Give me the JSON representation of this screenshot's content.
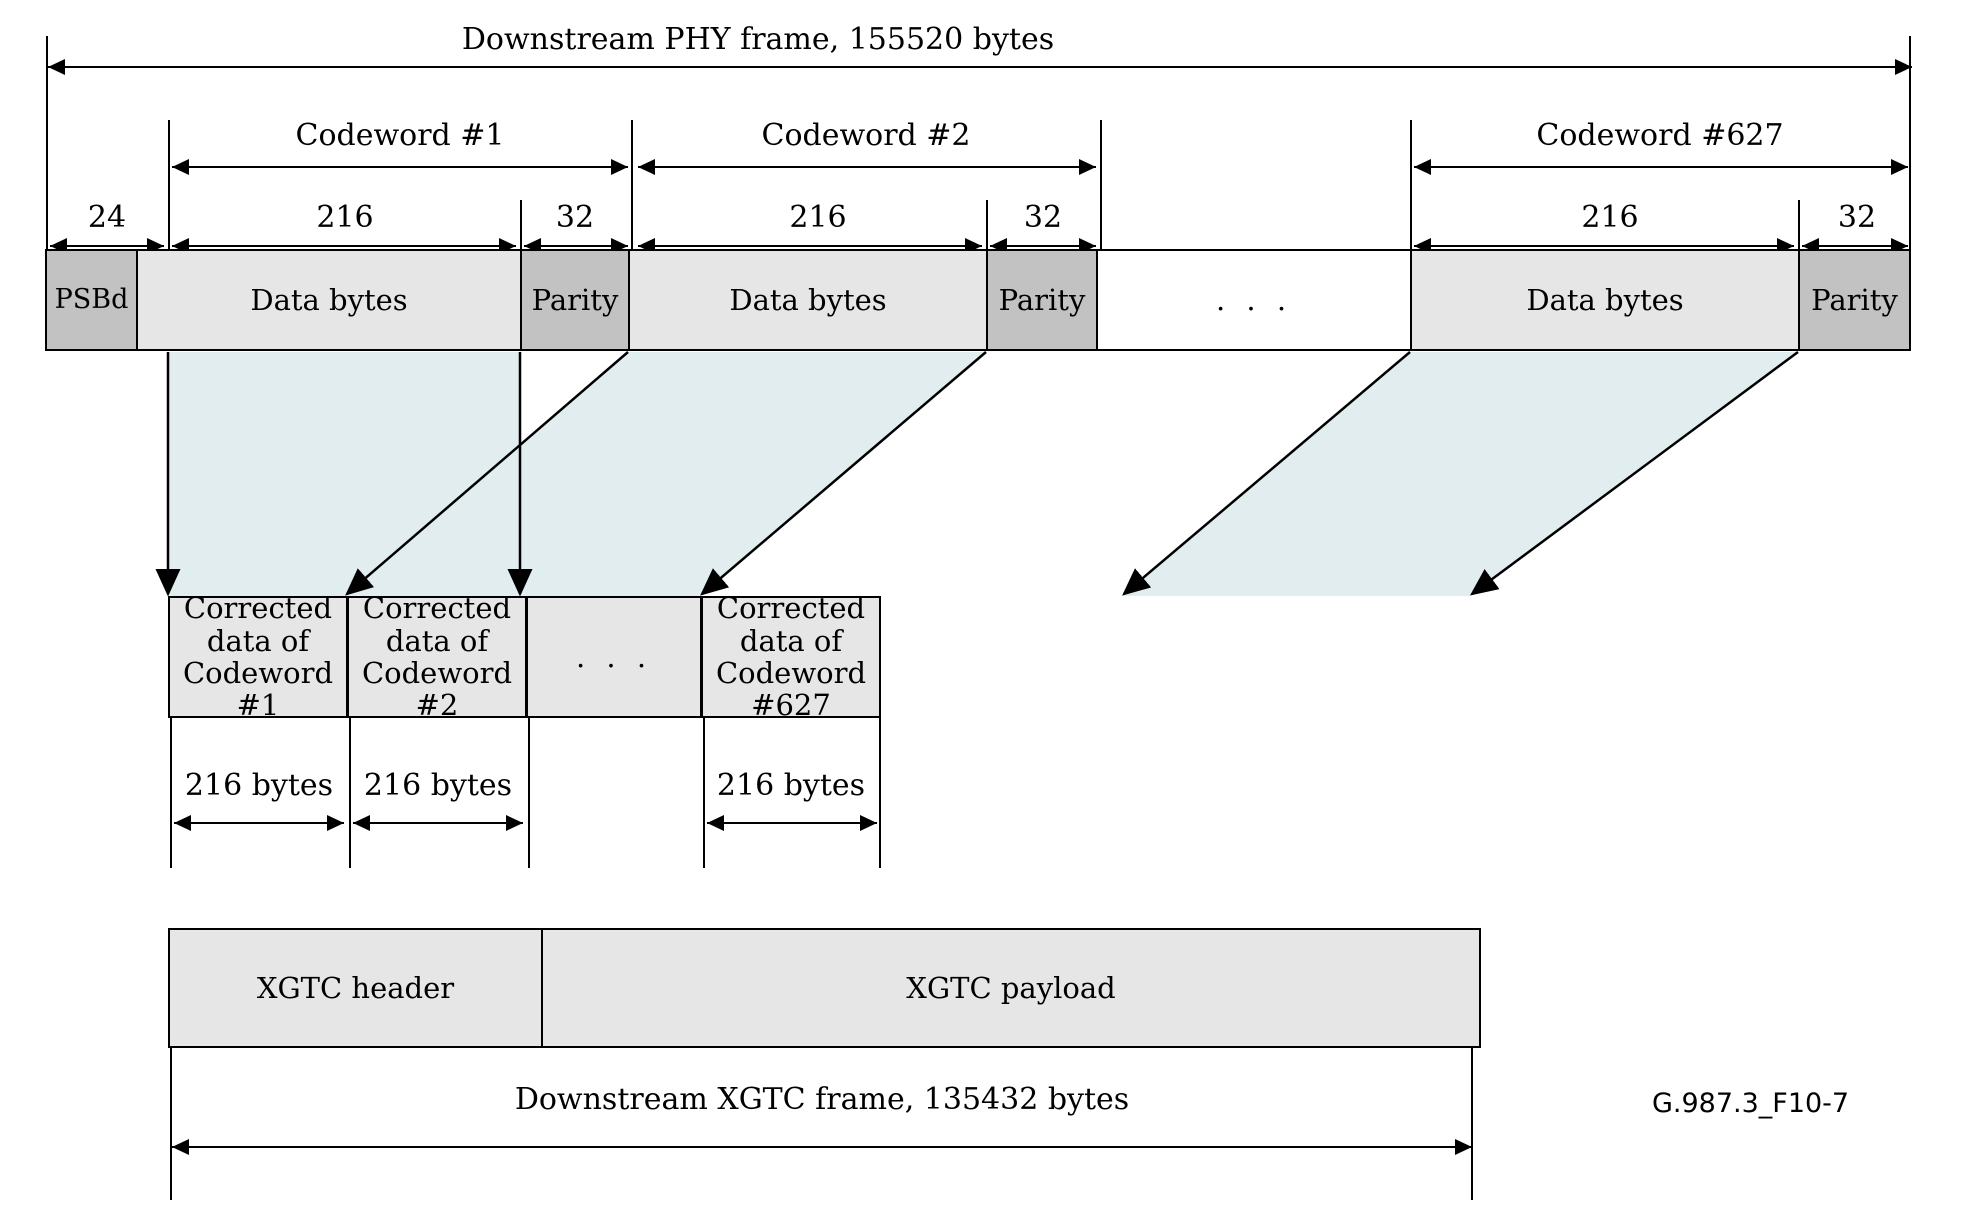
{
  "figure": {
    "id_label": "G.987.3_F10-7",
    "top_title": "Downstream PHY frame, 155520 bytes",
    "bottom_title": "Downstream XGTC frame, 135432 bytes"
  },
  "colors": {
    "light_grey": "#e6e6e6",
    "mid_grey": "#c2c2c2",
    "teal_fill": "#e2edf0",
    "line": "#000000",
    "white": "#ffffff"
  },
  "codeword_brackets": [
    {
      "label": "Codeword #1"
    },
    {
      "label": "Codeword #2"
    },
    {
      "label": "Codeword #627"
    }
  ],
  "size_labels": {
    "psbd": "24",
    "data": "216",
    "parity": "32"
  },
  "phy_row": {
    "cells": [
      {
        "label": "PSBd",
        "fill": "mid_grey",
        "kind": "psbd"
      },
      {
        "label": "Data bytes",
        "fill": "light_grey",
        "kind": "data"
      },
      {
        "label": "Parity",
        "fill": "mid_grey",
        "kind": "parity"
      },
      {
        "label": "Data bytes",
        "fill": "light_grey",
        "kind": "data"
      },
      {
        "label": "Parity",
        "fill": "mid_grey",
        "kind": "parity"
      },
      {
        "label": ". . .",
        "fill": "white",
        "kind": "ellipsis"
      },
      {
        "label": "Data bytes",
        "fill": "light_grey",
        "kind": "data"
      },
      {
        "label": "Parity",
        "fill": "mid_grey",
        "kind": "parity"
      }
    ]
  },
  "corrected_row": {
    "cells": [
      {
        "line1": "Corrected data of",
        "line2": "Codeword #1",
        "fill": "light_grey"
      },
      {
        "line1": "Corrected data of",
        "line2": "Codeword #2",
        "fill": "light_grey"
      },
      {
        "line1": ". . .",
        "line2": "",
        "fill": "light_grey"
      },
      {
        "line1": "Corrected data of",
        "line2": "Codeword #627",
        "fill": "light_grey"
      }
    ],
    "dimension_labels": [
      "216 bytes",
      "216 bytes",
      "216 bytes"
    ]
  },
  "xgtc_row": {
    "cells": [
      {
        "label": "XGTC header",
        "fill": "light_grey"
      },
      {
        "label": "XGTC payload",
        "fill": "light_grey"
      }
    ]
  },
  "chart_data": {
    "type": "table",
    "title": "XG-PON downstream PHY frame to XGTC frame mapping",
    "phy_frame_bytes": 155520,
    "xgtc_frame_bytes": 135432,
    "codeword_count": 627,
    "psbd_bytes": 24,
    "codeword_data_bytes": 216,
    "codeword_parity_bytes": 32
  }
}
